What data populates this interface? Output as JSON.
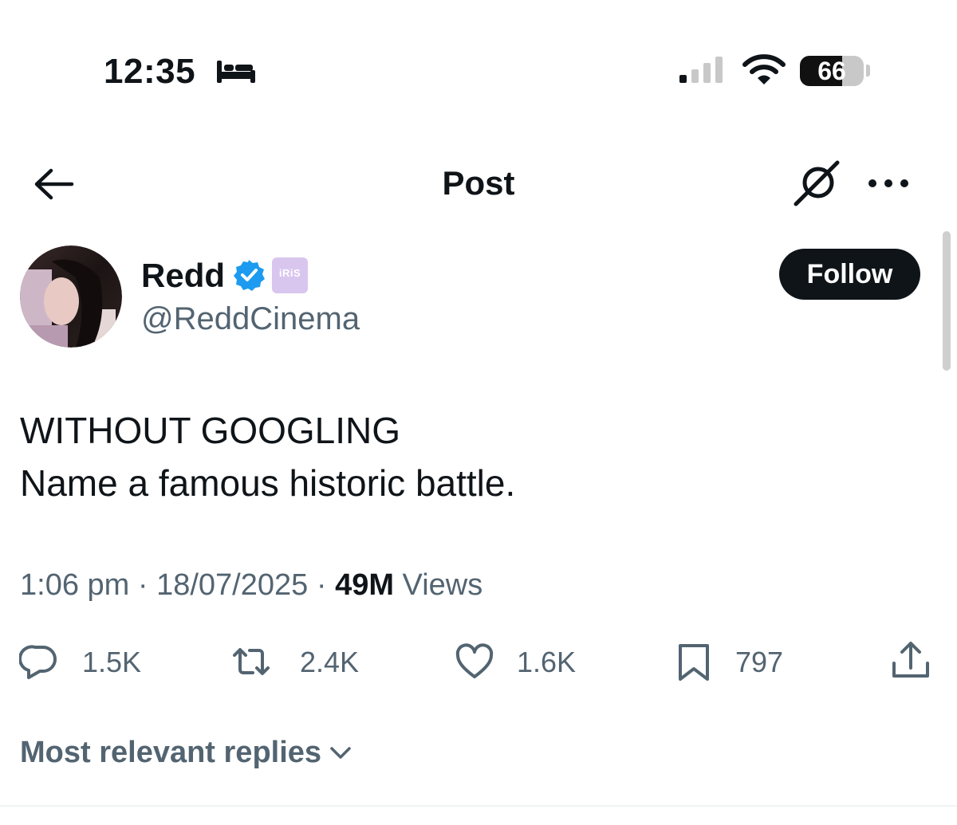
{
  "status_bar": {
    "time": "12:35",
    "battery_level": "66",
    "battery_fraction": 0.66,
    "focus_icon": "bed-icon",
    "signal_icon": "cellular-signal-icon",
    "wifi_icon": "wifi-icon"
  },
  "header": {
    "title": "Post",
    "back_icon": "arrow-left-icon",
    "grok_icon": "grok-icon",
    "more_icon": "more-horizontal-icon"
  },
  "author": {
    "name": "Redd",
    "handle": "@ReddCinema",
    "verified_icon": "verified-badge-icon",
    "affiliate_badge_text": "iRiS",
    "follow_label": "Follow"
  },
  "post": {
    "line1": "WITHOUT GOOGLING",
    "line2": "Name a famous historic battle."
  },
  "meta": {
    "time": "1:06 pm",
    "separator": " · ",
    "date": "18/07/2025",
    "views_count": "49M",
    "views_label": "Views"
  },
  "actions": {
    "replies": "1.5K",
    "reposts": "2.4K",
    "likes": "1.6K",
    "bookmarks": "797"
  },
  "replies_filter": {
    "label": "Most relevant replies"
  },
  "colors": {
    "text": "#0f1419",
    "secondary": "#536471",
    "verified": "#1d9bf0",
    "follow_bg": "#0f1419",
    "affiliate_bg": "#d9c6ee"
  }
}
